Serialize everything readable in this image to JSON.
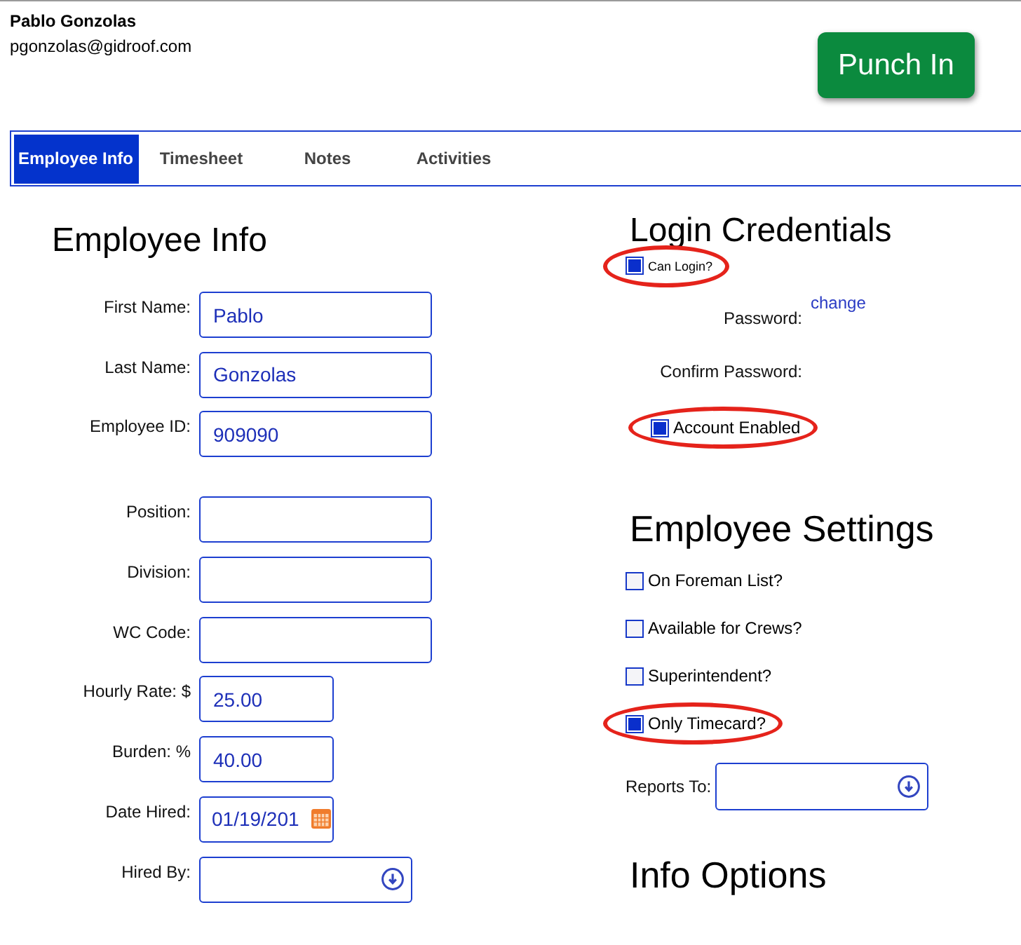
{
  "user": {
    "name": "Pablo Gonzolas",
    "email": "pgonzolas@gidroof.com"
  },
  "punch_button": {
    "label": "Punch In"
  },
  "tabs": [
    {
      "label": "Employee Info",
      "selected": true
    },
    {
      "label": "Timesheet",
      "selected": false
    },
    {
      "label": "Notes",
      "selected": false
    },
    {
      "label": "Activities",
      "selected": false
    }
  ],
  "employee_info": {
    "title": "Employee Info",
    "field_groups": [
      [
        {
          "label": "First Name:",
          "kind": "text",
          "value": "Pablo"
        },
        {
          "label": "Last Name:",
          "kind": "text",
          "value": "Gonzolas"
        },
        {
          "label": "Employee ID:",
          "kind": "text",
          "value": "909090"
        }
      ],
      [
        {
          "label": "Position:",
          "kind": "text"
        },
        {
          "label": "Division:",
          "kind": "text"
        },
        {
          "label": "WC Code:",
          "kind": "text"
        },
        {
          "label": "Hourly Rate: $",
          "kind": "number",
          "value": "25.00"
        },
        {
          "label": "Burden: %",
          "kind": "number",
          "value": "40.00"
        },
        {
          "label": "Date Hired:",
          "kind": "date",
          "value": "01/19/201"
        },
        {
          "label": "Hired By:",
          "kind": "select"
        }
      ]
    ]
  },
  "login_credentials": {
    "title": "Login Credentials",
    "can_login": {
      "label": "Can Login?",
      "checked": true,
      "highlighted": true
    },
    "password": {
      "label": "Password:",
      "link": "change"
    },
    "confirm_password": {
      "label": "Confirm Password:"
    },
    "account_enabled": {
      "label": "Account Enabled",
      "checked": true,
      "highlighted": true
    }
  },
  "employee_settings": {
    "title": "Employee Settings",
    "options": [
      {
        "label": "On Foreman List?",
        "checked": false,
        "highlighted": false
      },
      {
        "label": "Available for Crews?",
        "checked": false,
        "highlighted": false
      },
      {
        "label": "Superintendent?",
        "checked": false,
        "highlighted": false
      },
      {
        "label": "Only Timecard?",
        "checked": true,
        "highlighted": true
      }
    ],
    "reports_to": {
      "label": "Reports To:"
    }
  },
  "info_options": {
    "title": "Info Options"
  }
}
